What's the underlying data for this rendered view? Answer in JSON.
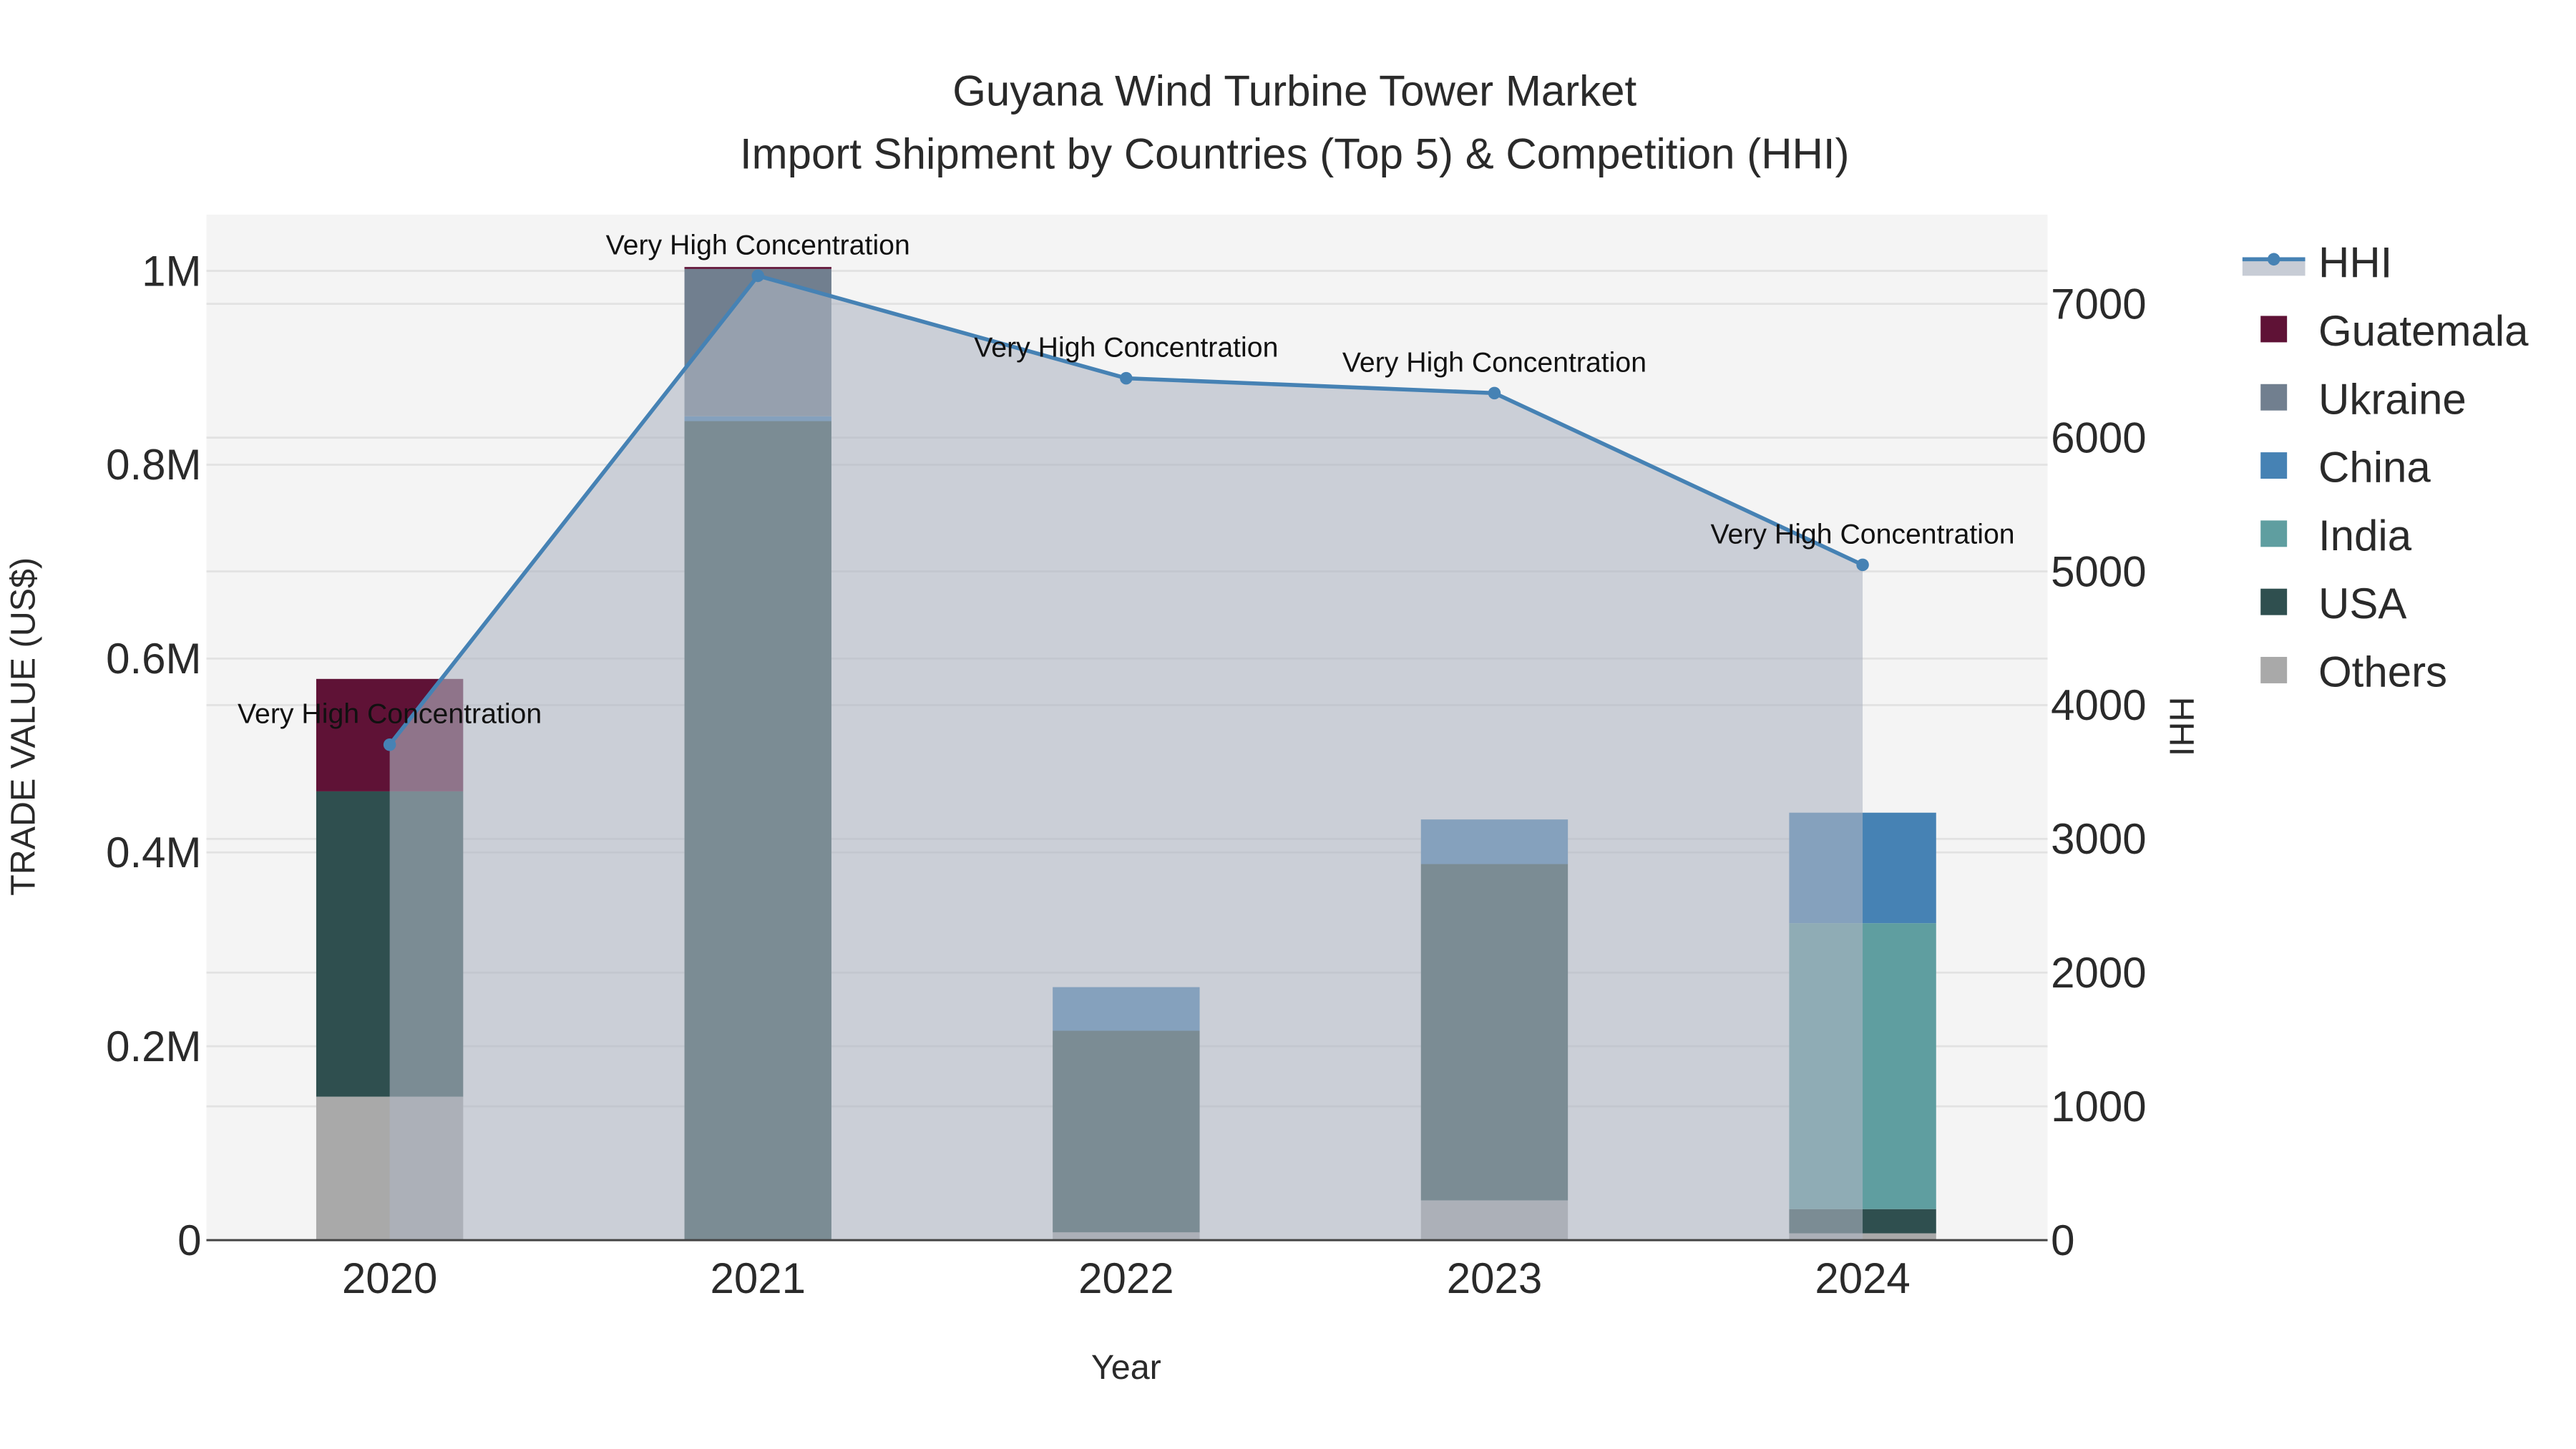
{
  "chart_data": {
    "type": "bar",
    "stacked": true,
    "title": "Guyana Wind Turbine Tower Market",
    "subtitle": "Import Shipment by Countries (Top 5) & Competition (HHI)",
    "xlabel": "Year",
    "ylabel": "TRADE VALUE (US$)",
    "y2label": "HHI",
    "categories": [
      "2020",
      "2021",
      "2022",
      "2023",
      "2024"
    ],
    "ylim": [
      0,
      1058000
    ],
    "y2lim": [
      0,
      7667
    ],
    "yticks": [
      {
        "v": 0,
        "label": "0"
      },
      {
        "v": 200000,
        "label": "0.2M"
      },
      {
        "v": 400000,
        "label": "0.4M"
      },
      {
        "v": 600000,
        "label": "0.6M"
      },
      {
        "v": 800000,
        "label": "0.8M"
      },
      {
        "v": 1000000,
        "label": "1M"
      }
    ],
    "y2ticks": [
      0,
      1000,
      2000,
      3000,
      4000,
      5000,
      6000,
      7000
    ],
    "grid": true,
    "legend_position": "right",
    "series": [
      {
        "name": "Others",
        "color": "#a9a9a9",
        "values": [
          148000,
          0,
          8000,
          41000,
          7000
        ]
      },
      {
        "name": "USA",
        "color": "#2f4f4f",
        "values": [
          315000,
          845000,
          208000,
          347000,
          25000
        ]
      },
      {
        "name": "India",
        "color": "#5f9ea0",
        "values": [
          0,
          0,
          0,
          0,
          295000
        ]
      },
      {
        "name": "China",
        "color": "#4682b4",
        "values": [
          0,
          5000,
          45000,
          46000,
          114000
        ]
      },
      {
        "name": "Ukraine",
        "color": "#717f8f",
        "values": [
          0,
          152000,
          0,
          0,
          0
        ]
      },
      {
        "name": "Guatemala",
        "color": "#5f1236",
        "values": [
          116000,
          2000,
          0,
          0,
          0
        ]
      }
    ],
    "line": {
      "name": "HHI",
      "color": "#4682b4",
      "values": [
        3704,
        7210,
        6444,
        6333,
        5049
      ]
    },
    "annotations": [
      "Very High Concentration",
      "Very High Concentration",
      "Very High Concentration",
      "Very High Concentration",
      "Very High Concentration"
    ],
    "legend_order": [
      "HHI",
      "Guatemala",
      "Ukraine",
      "China",
      "India",
      "USA",
      "Others"
    ]
  }
}
